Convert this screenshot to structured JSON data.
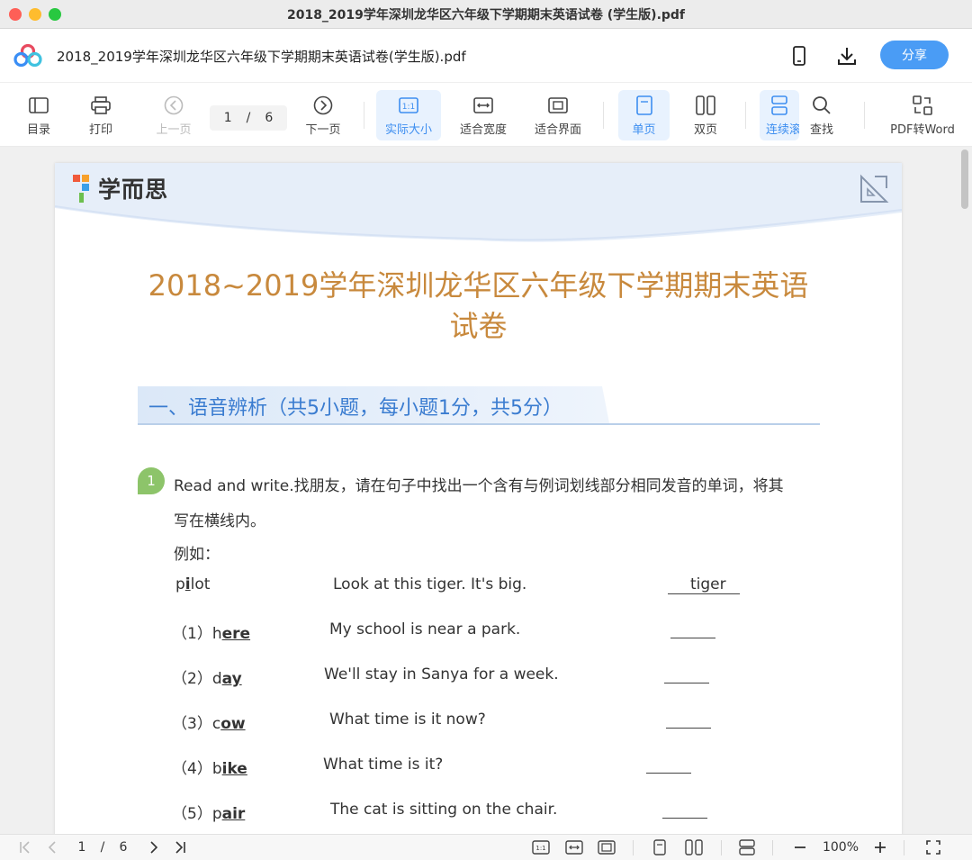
{
  "window": {
    "title": "2018_2019学年深圳龙华区六年级下学期期末英语试卷 (学生版).pdf"
  },
  "header": {
    "doc_name": "2018_2019学年深圳龙华区六年级下学期期末英语试卷(学生版).pdf",
    "share_label": "分享"
  },
  "toolbar": {
    "toc": "目录",
    "print": "打印",
    "prev_page": "上一页",
    "current_page": "1",
    "page_sep": "/",
    "total_pages": "6",
    "next_page": "下一页",
    "actual_size": "实际大小",
    "fit_width": "适合宽度",
    "fit_page": "适合界面",
    "single_page": "单页",
    "double_page": "双页",
    "continuous": "连续滚",
    "find": "查找",
    "pdf_to_word": "PDF转Word"
  },
  "document": {
    "brand": "学而思",
    "title_line1": "2018~2019学年深圳龙华区六年级下学期期末英语",
    "title_line2": "试卷",
    "section_heading": "一、语音辨析（共5小题，每小题1分，共5分）",
    "question_number": "1",
    "instruction_line1": "Read and write.找朋友，请在句子中找出一个含有与例词划线部分相同发音的单词，将其",
    "instruction_line2": "写在横线内。",
    "example_label": "例如：",
    "example": {
      "word_pre": "p",
      "word_mark": "i",
      "word_post": "lot",
      "sentence": "Look at this tiger. It's big.",
      "answer": "tiger"
    },
    "items": [
      {
        "num": "（1）",
        "pre": "h",
        "mark": "ere",
        "sentence": "My school is near a park."
      },
      {
        "num": "（2）",
        "pre": "d",
        "mark": "ay",
        "sentence": "We'll stay in Sanya for a week."
      },
      {
        "num": "（3）",
        "pre": "c",
        "mark": "ow",
        "sentence": "What time is it now?"
      },
      {
        "num": "（4）",
        "pre": "b",
        "mark": "ike",
        "sentence": "What time is it?"
      },
      {
        "num": "（5）",
        "pre": "p",
        "mark": "air",
        "sentence": "The cat is sitting on the chair."
      }
    ]
  },
  "statusbar": {
    "page": "1",
    "sep": "/",
    "total": "6",
    "zoom": "100%"
  },
  "colors": {
    "accent": "#4a9cf5",
    "title": "#c8893d",
    "section": "#3a7cd0",
    "badge": "#8dc46a"
  }
}
